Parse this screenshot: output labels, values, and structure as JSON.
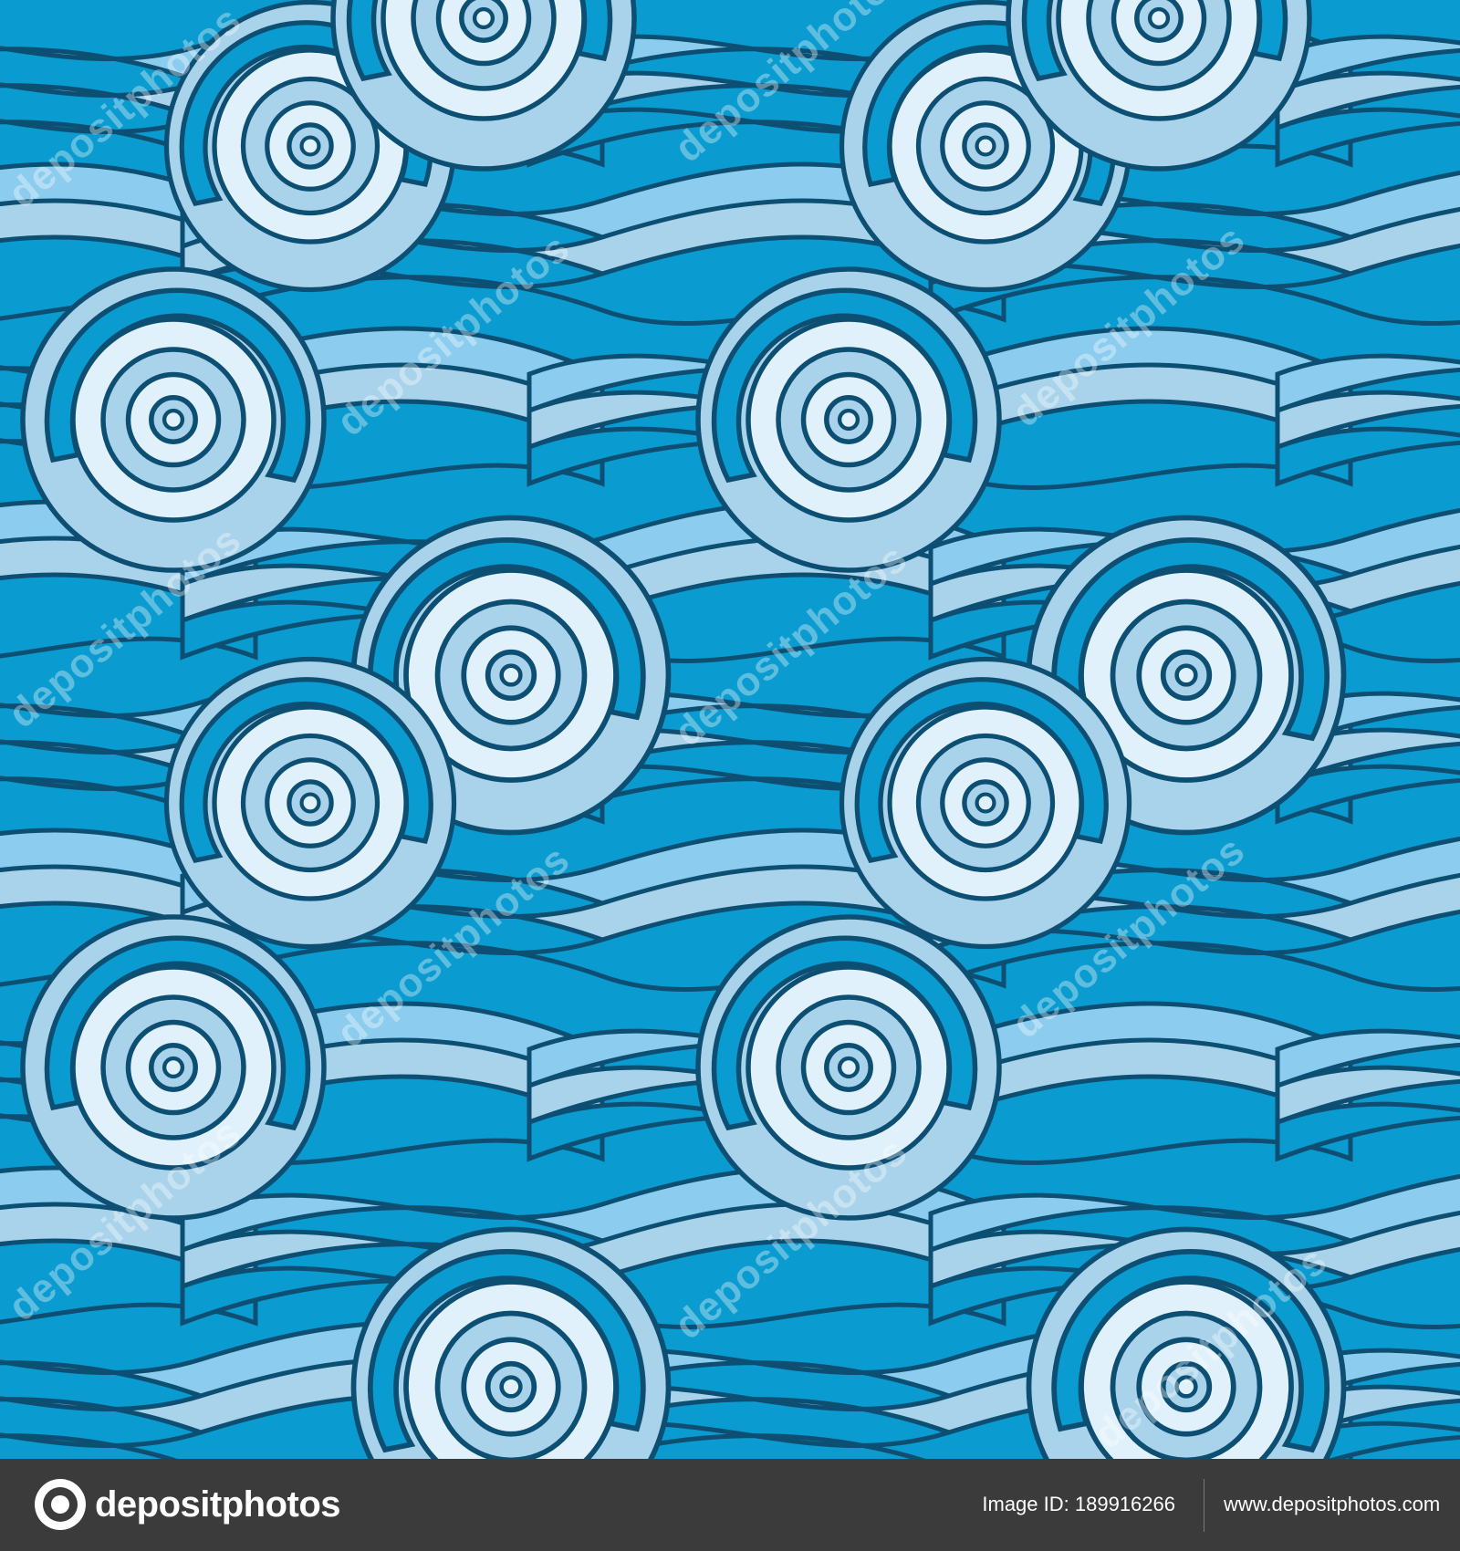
{
  "watermark": {
    "text": "depositphotos"
  },
  "footer": {
    "logo_text": "depositphotos",
    "image_id_label": "Image ID:",
    "image_id_value": "189916266",
    "site_url": "www.depositphotos.com"
  },
  "colors": {
    "deep": "#0a9bd0",
    "mid": "#a9d3ea",
    "light": "#e0f1fb",
    "sky": "#8ccdef",
    "outline": "#0d4f73",
    "footer_bg": "#3b3b3b"
  }
}
